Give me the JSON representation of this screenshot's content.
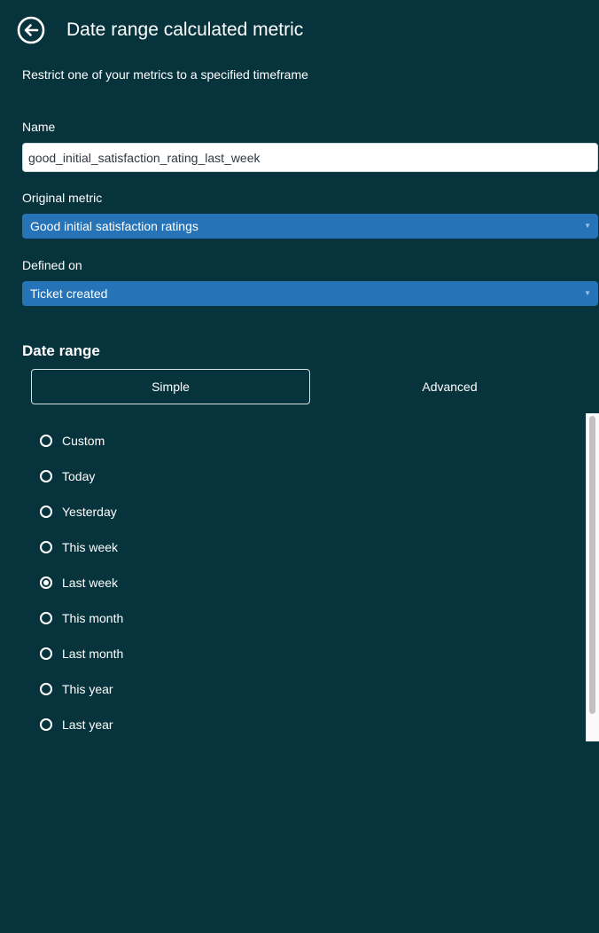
{
  "header": {
    "title": "Date range calculated metric",
    "back_icon": "arrow-left-circle-icon"
  },
  "subtitle": "Restrict one of your metrics to a specified timeframe",
  "name_field": {
    "label": "Name",
    "value": "good_initial_satisfaction_rating_last_week"
  },
  "original_metric": {
    "label": "Original metric",
    "selected": "Good initial satisfaction ratings"
  },
  "defined_on": {
    "label": "Defined on",
    "selected": "Ticket created"
  },
  "date_range": {
    "heading": "Date range",
    "tabs": [
      {
        "label": "Simple",
        "active": true
      },
      {
        "label": "Advanced",
        "active": false
      }
    ],
    "options": [
      {
        "label": "Custom",
        "checked": false
      },
      {
        "label": "Today",
        "checked": false
      },
      {
        "label": "Yesterday",
        "checked": false
      },
      {
        "label": "This week",
        "checked": false
      },
      {
        "label": "Last week",
        "checked": true
      },
      {
        "label": "This month",
        "checked": false
      },
      {
        "label": "Last month",
        "checked": false
      },
      {
        "label": "This year",
        "checked": false
      },
      {
        "label": "Last year",
        "checked": false
      }
    ]
  },
  "colors": {
    "background": "#07343c",
    "select_blue": "#2673b8"
  }
}
